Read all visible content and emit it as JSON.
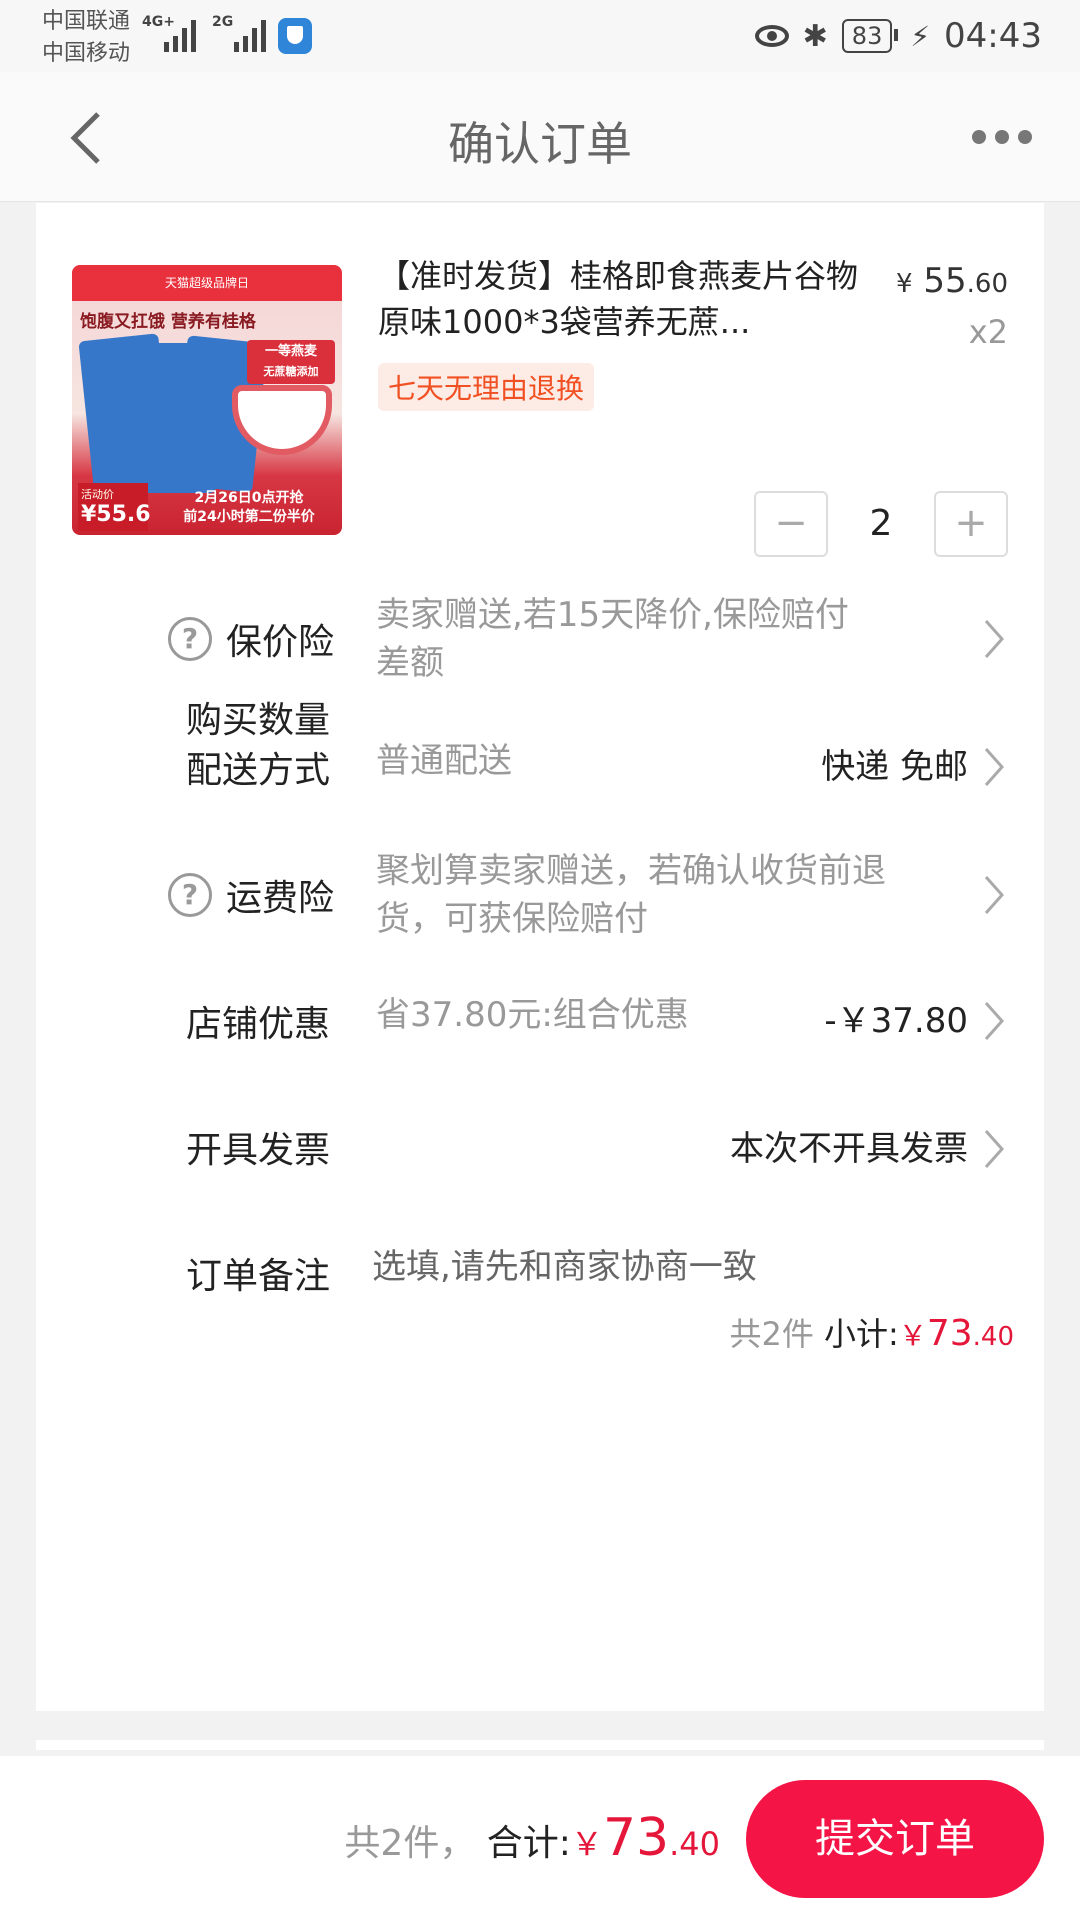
{
  "status_bar": {
    "carrier1": "中国联通",
    "carrier2": "中国移动",
    "net1": "4G+",
    "net2": "2G",
    "battery": "83",
    "time": "04:43"
  },
  "nav": {
    "title": "确认订单"
  },
  "product": {
    "title": "【准时发货】桂格即食燕麦片谷物原味1000*3袋营养无蔗...",
    "price_symbol": "¥",
    "price_int": "55",
    "price_dec": ".60",
    "quantity_label": "x2",
    "tag": "七天无理由退换",
    "image": {
      "top_banner": "天猫超级品牌日",
      "slogan": "饱腹又扛饿  营养有桂格",
      "badge_line1": "一等燕麦",
      "badge_line2": "无蔗糖添加",
      "price_caption": "活动价",
      "price": "¥55.6",
      "sale_line1": "2月26日0点开抢",
      "sale_line2": "前24小时第二份半价"
    }
  },
  "rows": {
    "quantity": {
      "label": "购买数量",
      "value": "2"
    },
    "price_protect": {
      "label": "保价险",
      "value": "卖家赠送,若15天降价,保险赔付差额"
    },
    "delivery": {
      "label": "配送方式",
      "value": "普通配送",
      "right": "快递 免邮"
    },
    "shipping_insurance": {
      "label": "运费险",
      "value": "聚划算卖家赠送，若确认收货前退货，可获保险赔付"
    },
    "store_discount": {
      "label": "店铺优惠",
      "value": "省37.80元:组合优惠",
      "right": "-￥37.80"
    },
    "invoice": {
      "label": "开具发票",
      "right": "本次不开具发票"
    },
    "remark": {
      "label": "订单备注",
      "placeholder": "选填,请先和商家协商一致"
    }
  },
  "subtotal": {
    "count": "共2件",
    "label": "小计:",
    "yen": "￥",
    "int": "73",
    "dec": ".40"
  },
  "bottom": {
    "count": "共2件，",
    "label": "合计:",
    "yen": "￥",
    "int": "73",
    "dec": ".40",
    "submit": "提交订单"
  },
  "colors": {
    "accent": "#f41446",
    "price_red": "#e4163a",
    "tag_orange": "#f15022"
  }
}
